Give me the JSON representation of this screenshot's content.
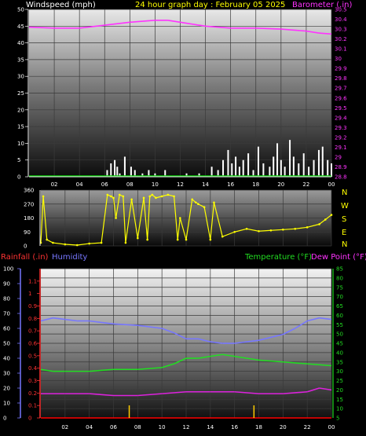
{
  "header": {
    "windspeed_label": "Windspeed (mph)",
    "title": "24 hour graph day : February 05 2025",
    "barometer_label": "Barometer (.in)"
  },
  "bottom_header": {
    "rain_label": "Rainfall (.in)",
    "humidity_label": "Humidity",
    "temp_label": "Temperature (°F)",
    "dew_label": "Dew Point (°F)"
  },
  "compass": [
    "N",
    "W",
    "S",
    "E",
    "N"
  ],
  "colors": {
    "wind": "#ffffff",
    "barometer": "#ff33ff",
    "direction": "#ffff00",
    "rain": "#ff0000",
    "humidity": "#7777ff",
    "temperature": "#22dd22",
    "dewpoint": "#dd22dd",
    "header_yellow": "#ffff00",
    "header_magenta": "#ff33ff",
    "header_white": "#ffffff"
  },
  "chart_data": [
    {
      "type": "line",
      "name": "wind-barometer",
      "x_ticks": [
        "02",
        "04",
        "06",
        "08",
        "10",
        "12",
        "14",
        "16",
        "18",
        "20",
        "22",
        "00"
      ],
      "wind_axis": {
        "ylim": [
          0,
          50
        ],
        "ticks": [
          "0",
          "5",
          "10",
          "15",
          "20",
          "25",
          "30",
          "35",
          "40",
          "45",
          "50"
        ]
      },
      "baro_axis": {
        "ylim": [
          28.8,
          30.5
        ],
        "ticks": [
          "28.8",
          "28.9",
          "29",
          "29.1",
          "29.2",
          "29.3",
          "29.4",
          "29.5",
          "29.6",
          "29.7",
          "29.8",
          "29.9",
          "30",
          "30.1",
          "30.2",
          "30.3",
          "30.4",
          "30.5"
        ]
      },
      "series": [
        {
          "name": "Barometer (.in)",
          "axis": "right",
          "x": [
            0,
            2,
            4,
            6,
            8,
            10,
            11,
            12,
            14,
            16,
            18,
            20,
            22,
            23,
            24
          ],
          "y": [
            30.32,
            30.31,
            30.31,
            30.34,
            30.37,
            30.39,
            30.39,
            30.37,
            30.33,
            30.31,
            30.31,
            30.3,
            30.28,
            30.26,
            30.25
          ]
        },
        {
          "name": "Windspeed (mph)",
          "axis": "left",
          "x": [
            6.2,
            6.5,
            6.8,
            7.0,
            7.2,
            7.6,
            8.1,
            8.4,
            9.0,
            9.5,
            10.0,
            10.8,
            12.5,
            13.5,
            14.5,
            15.0,
            15.4,
            15.8,
            16.1,
            16.4,
            16.7,
            17.0,
            17.4,
            17.8,
            18.2,
            18.6,
            19.1,
            19.4,
            19.7,
            20.0,
            20.3,
            20.7,
            21.0,
            21.4,
            21.8,
            22.2,
            22.6,
            23.0,
            23.3,
            23.7,
            24.0
          ],
          "y": [
            2,
            4,
            5,
            3,
            1,
            6,
            3,
            2,
            1,
            2,
            1,
            2,
            1,
            1,
            3,
            2,
            5,
            8,
            4,
            6,
            3,
            5,
            7,
            2,
            9,
            4,
            3,
            6,
            10,
            5,
            3,
            11,
            6,
            4,
            7,
            3,
            5,
            8,
            9,
            5,
            4
          ]
        }
      ]
    },
    {
      "type": "scatter",
      "name": "wind-direction",
      "ylim": [
        0,
        360
      ],
      "y_ticks": [
        "0",
        "90",
        "180",
        "270",
        "360"
      ],
      "x_ticks": [
        "02",
        "04",
        "06",
        "08",
        "10",
        "12",
        "14",
        "16",
        "18",
        "20",
        "22",
        "00"
      ],
      "series": [
        {
          "name": "Direction",
          "x": [
            0,
            0.2,
            0.5,
            1,
            2,
            3,
            4,
            5,
            5.5,
            5.8,
            6,
            6.2,
            6.5,
            6.8,
            7,
            7.5,
            8,
            8.5,
            8.8,
            9,
            9.2,
            9.5,
            10,
            10.5,
            11,
            11.3,
            11.5,
            12,
            12.5,
            12.8,
            13,
            13.5,
            14,
            14.3,
            15,
            16,
            17,
            18,
            19,
            20,
            21,
            22,
            23,
            23.5,
            24
          ],
          "y": [
            20,
            320,
            40,
            20,
            10,
            5,
            15,
            20,
            330,
            320,
            310,
            180,
            330,
            320,
            20,
            300,
            50,
            310,
            40,
            320,
            330,
            310,
            320,
            330,
            320,
            40,
            180,
            40,
            300,
            280,
            270,
            250,
            40,
            280,
            60,
            90,
            110,
            95,
            100,
            105,
            110,
            120,
            140,
            170,
            200
          ]
        }
      ]
    },
    {
      "type": "line",
      "name": "rain-humidity-temp-dew",
      "x_ticks": [
        "02",
        "04",
        "06",
        "08",
        "10",
        "12",
        "14",
        "16",
        "18",
        "20",
        "22",
        "00"
      ],
      "humidity_axis": {
        "ylim": [
          0,
          100
        ],
        "ticks": [
          "0",
          "10",
          "20",
          "30",
          "40",
          "50",
          "60",
          "70",
          "80",
          "90",
          "100"
        ]
      },
      "rain_axis": {
        "ylim": [
          0,
          1.2
        ],
        "ticks": [
          "0",
          "0.1",
          "0.2",
          "0.3",
          "0.4",
          "0.5",
          "0.6",
          "0.7",
          "0.8",
          "0.9",
          "1",
          "1.1"
        ]
      },
      "temp_axis": {
        "ylim": [
          5,
          85
        ],
        "ticks": [
          "5",
          "10",
          "15",
          "20",
          "25",
          "30",
          "35",
          "40",
          "45",
          "50",
          "55",
          "60",
          "65",
          "70",
          "75",
          "80",
          "85"
        ]
      },
      "series": [
        {
          "name": "Humidity",
          "axis": "left",
          "x": [
            0,
            1,
            2,
            3,
            4,
            6,
            8,
            10,
            11,
            12,
            13,
            14,
            15,
            16,
            18,
            20,
            21,
            22,
            23,
            24
          ],
          "y": [
            65,
            67,
            66,
            65,
            65,
            63,
            62,
            60,
            57,
            53,
            53,
            51,
            50,
            50,
            52,
            56,
            60,
            65,
            67,
            66
          ]
        },
        {
          "name": "Temperature (°F)",
          "axis": "right",
          "x": [
            0,
            1,
            2,
            4,
            6,
            8,
            10,
            11,
            12,
            13,
            14,
            15,
            16,
            18,
            20,
            22,
            24
          ],
          "y": [
            31,
            30,
            30,
            30,
            31,
            31,
            32,
            34,
            37,
            37,
            38,
            39,
            38,
            36,
            35,
            34,
            33
          ]
        },
        {
          "name": "Dew Point (°F)",
          "axis": "right",
          "x": [
            0,
            2,
            4,
            6,
            8,
            10,
            12,
            14,
            16,
            18,
            20,
            22,
            23,
            24
          ],
          "y": [
            18,
            18,
            18,
            17,
            17,
            18,
            19,
            19,
            19,
            18,
            18,
            19,
            21,
            20
          ]
        },
        {
          "name": "Rainfall (.in)",
          "axis": "rain",
          "x": [
            0,
            24
          ],
          "y": [
            0,
            0
          ]
        }
      ],
      "markers": [
        {
          "x": 7.3
        },
        {
          "x": 17.6
        }
      ]
    }
  ]
}
